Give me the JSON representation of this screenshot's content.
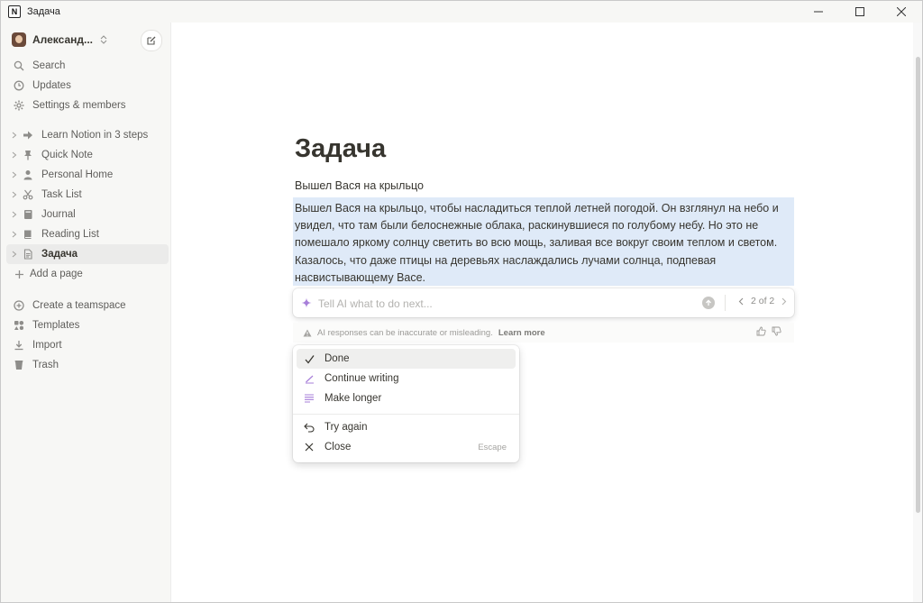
{
  "window": {
    "title": "Задача",
    "controls": [
      "minimize",
      "maximize",
      "close"
    ]
  },
  "sidebar": {
    "workspace_name": "Александ...",
    "top_items": [
      {
        "label": "Search",
        "icon": "search-icon"
      },
      {
        "label": "Updates",
        "icon": "clock-icon"
      },
      {
        "label": "Settings & members",
        "icon": "gear-icon"
      }
    ],
    "pages": [
      {
        "label": "Learn Notion in 3 steps",
        "icon": "arrow-right-icon"
      },
      {
        "label": "Quick Note",
        "icon": "pin-icon"
      },
      {
        "label": "Personal Home",
        "icon": "person-icon"
      },
      {
        "label": "Task List",
        "icon": "scissors-icon"
      },
      {
        "label": "Journal",
        "icon": "notebook-icon"
      },
      {
        "label": "Reading List",
        "icon": "book-icon"
      },
      {
        "label": "Задача",
        "icon": "page-icon",
        "active": true
      }
    ],
    "add_page": "Add a page",
    "bottom_items": [
      {
        "label": "Create a teamspace",
        "icon": "team-icon"
      },
      {
        "label": "Templates",
        "icon": "templates-icon"
      },
      {
        "label": "Import",
        "icon": "import-icon"
      },
      {
        "label": "Trash",
        "icon": "trash-icon"
      }
    ]
  },
  "page": {
    "title": "Задача",
    "first_line": "Вышел Вася на крыльцо",
    "ai_text": "Вышел Вася на крыльцо, чтобы насладиться теплой летней погодой. Он взглянул на небо и увидел, что там были белоснежные облака, раскинувшиеся по голубому небу. Но это не помешало яркому солнцу светить во всю мощь, заливая все вокруг своим теплом и светом. Казалось, что даже птицы на деревьях наслаждались лучами солнца, подпевая насвистывающему Васе."
  },
  "ai": {
    "input_placeholder": "Tell AI what to do next...",
    "pager": "2 of 2",
    "notice": "AI responses can be inaccurate or misleading.",
    "learn_more": "Learn more"
  },
  "menu": {
    "items": [
      {
        "label": "Done",
        "icon": "check-icon"
      },
      {
        "label": "Continue writing",
        "icon": "pen-icon"
      },
      {
        "label": "Make longer",
        "icon": "lines-icon"
      }
    ],
    "secondary": [
      {
        "label": "Try again",
        "icon": "undo-icon"
      },
      {
        "label": "Close",
        "icon": "close-icon",
        "shortcut": "Escape"
      }
    ]
  },
  "colors": {
    "accent_purple": "#a77fd9",
    "selection": "#dfeaf8",
    "sidebar_bg": "#f7f7f5"
  }
}
